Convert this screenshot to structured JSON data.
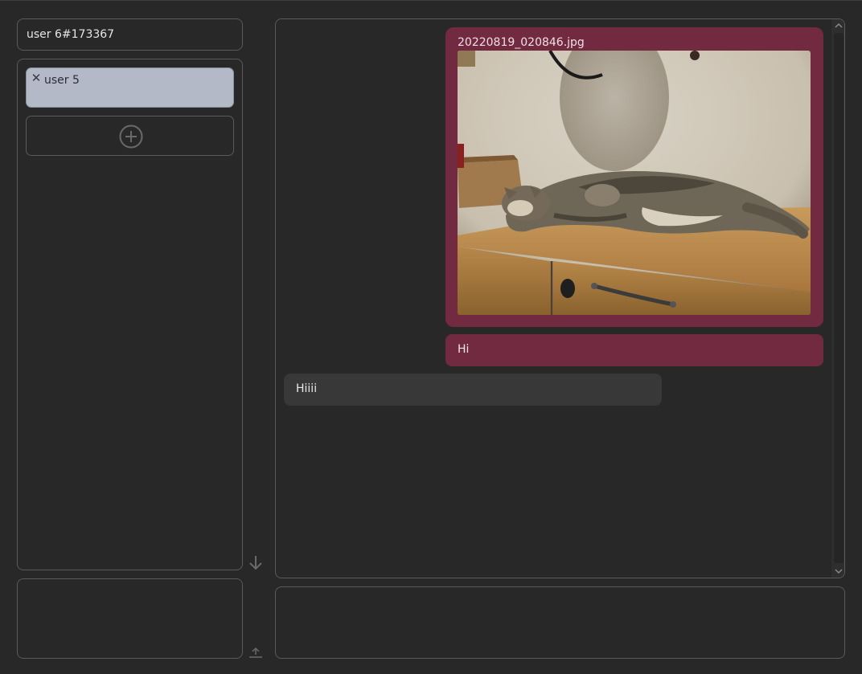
{
  "profile": {
    "username": "user 6#173367"
  },
  "contacts": {
    "items": [
      {
        "name": "user 5",
        "remove_icon": "close-icon"
      }
    ],
    "add_icon": "plus-circle-icon"
  },
  "controls": {
    "scroll_down_icon": "arrow-down-icon",
    "upload_icon": "upload-icon"
  },
  "chat": {
    "messages": [
      {
        "direction": "outgoing",
        "type": "image",
        "filename": "20220819_020846.jpg"
      },
      {
        "direction": "outgoing",
        "type": "text",
        "text": "Hi"
      },
      {
        "direction": "incoming",
        "type": "text",
        "text": "Hiiii"
      }
    ]
  },
  "compose": {
    "value": "",
    "placeholder": ""
  },
  "colors": {
    "background": "#282828",
    "outgoing_bubble": "#722a40",
    "incoming_bubble": "#383838",
    "contact_card": "#b4b9c8",
    "border": "#5a5a5a"
  }
}
